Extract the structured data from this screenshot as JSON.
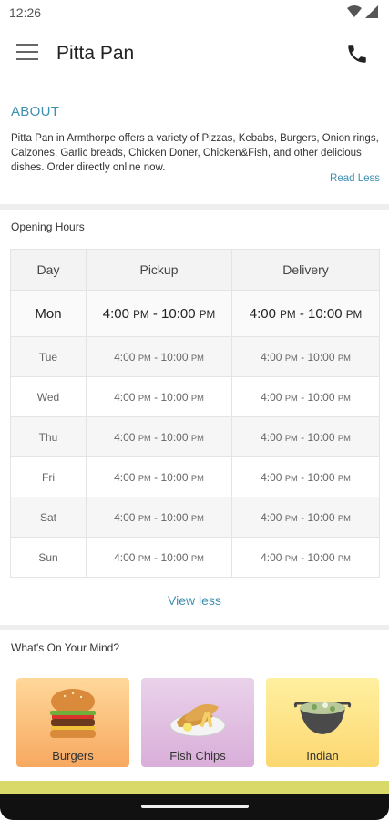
{
  "status_bar": {
    "time": "12:26"
  },
  "app_bar": {
    "title": "Pitta Pan"
  },
  "about": {
    "heading": "ABOUT",
    "text": "Pitta Pan in Armthorpe offers a variety of  Pizzas, Kebabs, Burgers, Onion rings, Calzones, Garlic breads, Chicken Doner, Chicken&Fish, and other delicious dishes. Order directly online now.",
    "read_less": "Read Less"
  },
  "opening_hours": {
    "title": "Opening Hours",
    "headers": {
      "day": "Day",
      "pickup": "Pickup",
      "delivery": "Delivery"
    },
    "rows": [
      {
        "day": "Mon",
        "pickup_open": "4:00",
        "pickup_close": "10:00",
        "delivery_open": "4:00",
        "delivery_close": "10:00"
      },
      {
        "day": "Tue",
        "pickup_open": "4:00",
        "pickup_close": "10:00",
        "delivery_open": "4:00",
        "delivery_close": "10:00"
      },
      {
        "day": "Wed",
        "pickup_open": "4:00",
        "pickup_close": "10:00",
        "delivery_open": "4:00",
        "delivery_close": "10:00"
      },
      {
        "day": "Thu",
        "pickup_open": "4:00",
        "pickup_close": "10:00",
        "delivery_open": "4:00",
        "delivery_close": "10:00"
      },
      {
        "day": "Fri",
        "pickup_open": "4:00",
        "pickup_close": "10:00",
        "delivery_open": "4:00",
        "delivery_close": "10:00"
      },
      {
        "day": "Sat",
        "pickup_open": "4:00",
        "pickup_close": "10:00",
        "delivery_open": "4:00",
        "delivery_close": "10:00"
      },
      {
        "day": "Sun",
        "pickup_open": "4:00",
        "pickup_close": "10:00",
        "delivery_open": "4:00",
        "delivery_close": "10:00"
      }
    ],
    "meridiem": "PM",
    "separator": " - ",
    "view_less": "View less"
  },
  "mind": {
    "title": "What's On Your Mind?",
    "categories": [
      {
        "label": "Burgers",
        "icon": "burger-icon"
      },
      {
        "label": "Fish  Chips",
        "icon": "fish-chips-icon"
      },
      {
        "label": "Indian",
        "icon": "curry-icon"
      }
    ]
  },
  "colors": {
    "accent": "#3f8fb0",
    "strip": "#d9d96a"
  }
}
